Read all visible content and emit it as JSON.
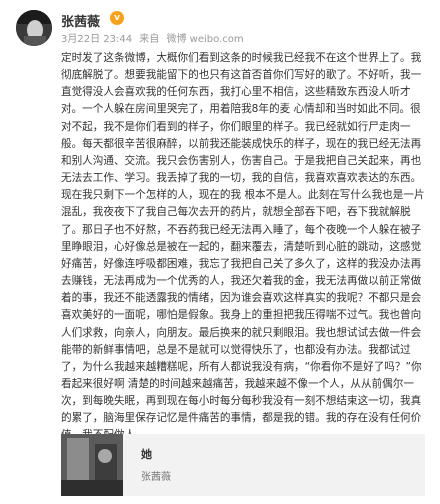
{
  "post": {
    "author": "张茜薇",
    "vip_badge": "v",
    "time": "3月22日 23:44",
    "source_prefix": "来自",
    "source": "微博 weibo.com",
    "body": "定时发了这条微博，大概你们看到这条的时候我已经我不在这个世界上了。我彻底解脱了。想要我能留下的也只有这首否首你们写好的歌了。不好听，我一直觉得没人会喜欢我的任何东西，我打心里不相信，这些精致东西没人听才对。一个人躲在房间里哭完了，用着陪我8年的麦 心情却和当时如此不同。很对不起，我不是你们看到的样子，你们眼里的样子。我已经就如行尸走肉一般。每天都很辛苦很麻醉，以前我还能装成快乐的样子，现在的我已经无法再和别人沟通、交流。我只会伤害别人，伤害自己。于是我把自己关起来，再也无法去工作、学习。我丢掉了我的一切，我的自信，我喜欢喜欢表达的东西。现在我只剩下一个怎样的人，现在的我 根本不是人。此刻在写什么我也是一片混乱，我夜夜下了我自己每次去开的药片，就想全部吞下吧，吞下我就解脱了。那日子也不好熬，不吞药我已经无法再入睡了，每个夜晚一个人躲在被子里睁眼泪，心好像总是被在一起的，翻来覆去，清楚听到心脏的跳动，这感觉好痛苦，好像连呼吸都困难，我忘了我把自己关了多久了，这样的我没办法再去赚钱，无法再成为一个优秀的人，我还欠着我的金，我无法再做以前正常做着的事，我还不能透露我的情绪，因为谁会喜欢这样真实的我呢？不都只是会喜欢美好的一面呢，哪怕是假象。我身上的重担把我压得喘不过气。我也曾向人们求救，向亲人，向朋友。最后换来的就只剩眼泪。我也想试试去做一件会能带的新鲜事情吧，总是不是就可以觉得快乐了，也都没有办法。我都试过了，为什么我越来越糟糕呢，所有人都说我没有病，“你看你不是好了吗？”你看起来很好啊 清楚的时间越来越痛苦，我越来越不像一个人，从从前偶尔一次，到每晚失眠，再到现在每小时每分每秒我没有一刻不想结束这一切，我真的累了，脑海里保存记忆是件痛苦的事情，都是我的错。我的存在没有任何价值。我不配做人。"
  },
  "card": {
    "title": "她",
    "subtitle": "张茜薇"
  }
}
